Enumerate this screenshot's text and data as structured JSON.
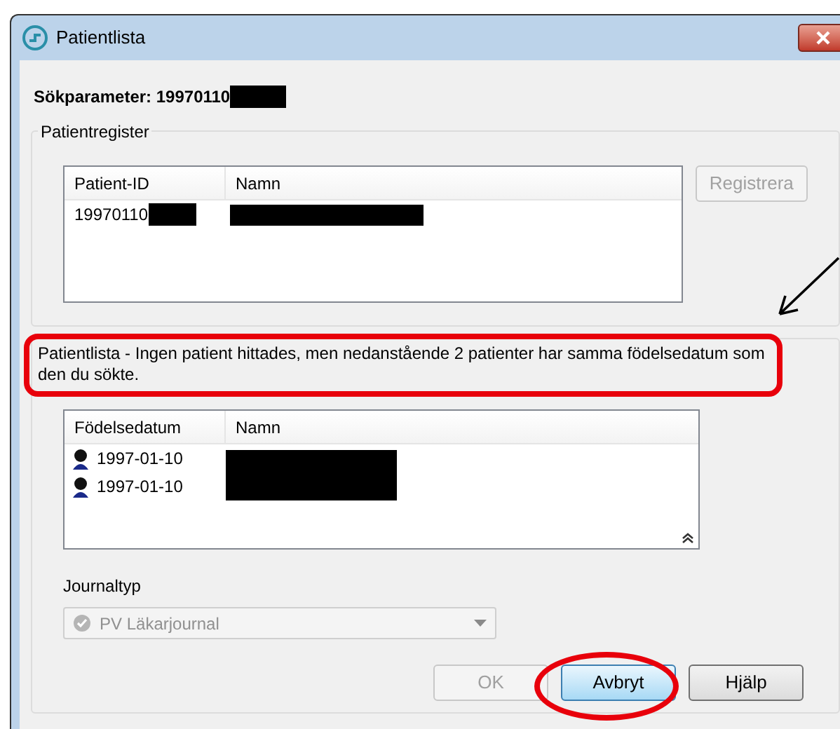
{
  "window": {
    "title": "Patientlista"
  },
  "search": {
    "label": "Sökparameter: 19970110"
  },
  "patient_register": {
    "title": "Patientregister",
    "columns": [
      "Patient-ID",
      "Namn"
    ],
    "rows": [
      {
        "patient_id": "19970110"
      }
    ],
    "register_button": {
      "label": "Registrera",
      "disabled": true
    }
  },
  "message": "Patientlista - Ingen patient hittades, men nedanstående 2 patienter har samma födelsedatum som den du sökte.",
  "birth_list": {
    "columns": [
      "Födelsedatum",
      "Namn"
    ],
    "rows": [
      {
        "date": "1997-01-10"
      },
      {
        "date": "1997-01-10"
      }
    ]
  },
  "journal_type": {
    "label": "Journaltyp",
    "value": "PV Läkarjournal",
    "disabled": true
  },
  "buttons": [
    {
      "label": "OK",
      "disabled": true,
      "focused": false
    },
    {
      "label": "Avbryt",
      "disabled": false,
      "focused": true
    },
    {
      "label": "Hjälp",
      "disabled": false,
      "focused": false
    }
  ]
}
